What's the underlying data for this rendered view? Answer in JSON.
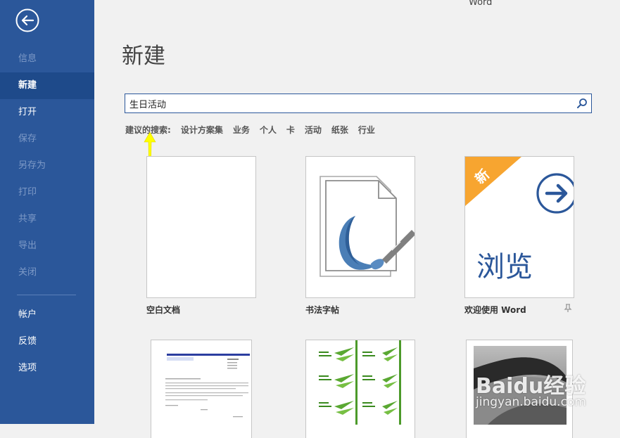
{
  "app_title": "Word",
  "page_title": "新建",
  "sidebar": {
    "items": [
      {
        "label": "信息",
        "state": "disabled"
      },
      {
        "label": "新建",
        "state": "active"
      },
      {
        "label": "打开",
        "state": "enabled"
      },
      {
        "label": "保存",
        "state": "disabled"
      },
      {
        "label": "另存为",
        "state": "disabled"
      },
      {
        "label": "打印",
        "state": "disabled"
      },
      {
        "label": "共享",
        "state": "disabled"
      },
      {
        "label": "导出",
        "state": "disabled"
      },
      {
        "label": "关闭",
        "state": "disabled"
      },
      {
        "label": "帐户",
        "state": "enabled"
      },
      {
        "label": "反馈",
        "state": "enabled"
      },
      {
        "label": "选项",
        "state": "enabled"
      }
    ]
  },
  "search": {
    "value": "生日活动"
  },
  "suggested": {
    "label": "建议的搜索:",
    "items": [
      "设计方案集",
      "业务",
      "个人",
      "卡",
      "活动",
      "纸张",
      "行业"
    ]
  },
  "templates": [
    {
      "label": "空白文档"
    },
    {
      "label": "书法字帖"
    },
    {
      "label": "欢迎使用 Word",
      "badge": "新",
      "browse_text": "浏览",
      "pinnable": true
    }
  ],
  "colors": {
    "sidebar": "#2b579a",
    "sidebar_active": "#1e4a8a",
    "badge": "#f7a530",
    "accent": "#2b579a",
    "annotation": "#ffff00"
  },
  "watermark": {
    "text": "Baidu经验",
    "url": "jingyan.baidu.com"
  }
}
